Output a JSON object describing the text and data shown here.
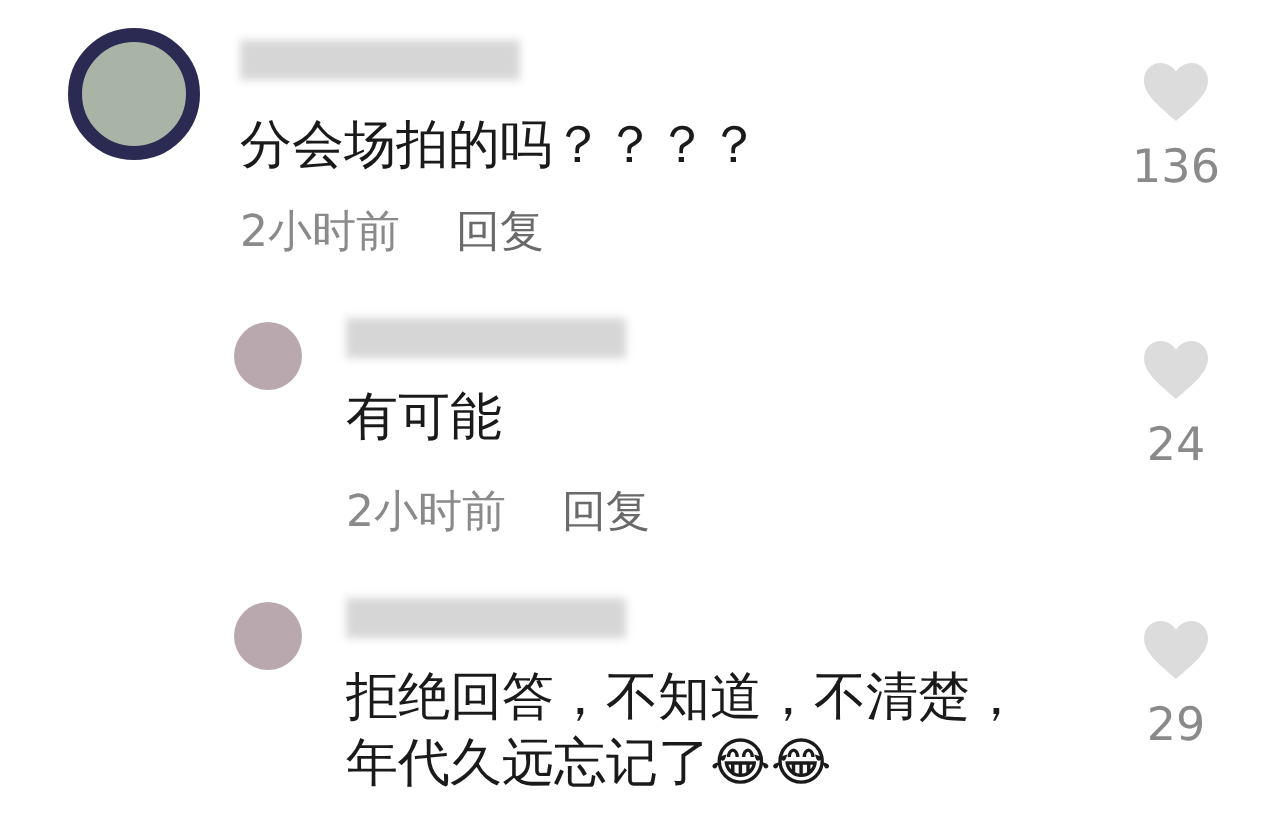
{
  "comments": [
    {
      "text": "分会场拍的吗？？？？",
      "time": "2小时前",
      "reply_label": "回复",
      "liked": false,
      "likes": "136",
      "replies": [
        {
          "text": "有可能",
          "time": "2小时前",
          "reply_label": "回复",
          "liked": false,
          "likes": "24"
        },
        {
          "text": "拒绝回答，不知道，不清楚，年代久远忘记了😂😂",
          "liked": false,
          "likes": "29"
        }
      ]
    }
  ]
}
